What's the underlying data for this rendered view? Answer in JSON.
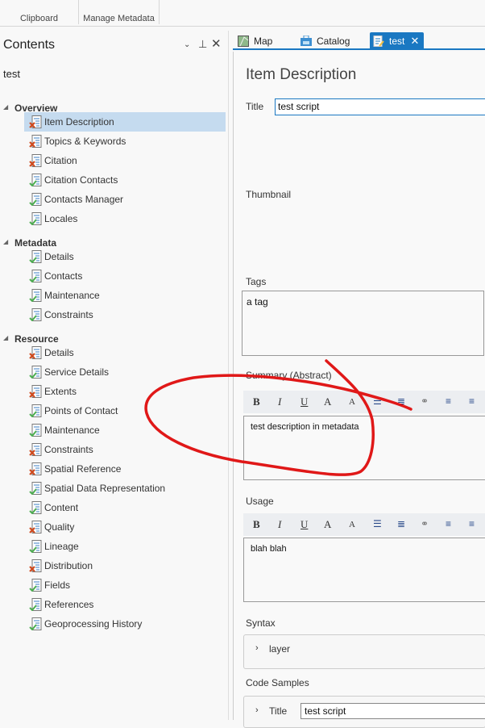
{
  "ribbon": {
    "groups": [
      "Clipboard",
      "Manage Metadata"
    ]
  },
  "contents": {
    "title": "Contents",
    "root": "test",
    "groups": [
      {
        "label": "Overview",
        "items": [
          {
            "label": "Item Description",
            "status": "error",
            "selected": true
          },
          {
            "label": "Topics & Keywords",
            "status": "error"
          },
          {
            "label": "Citation",
            "status": "error"
          },
          {
            "label": "Citation Contacts",
            "status": "ok"
          },
          {
            "label": "Contacts Manager",
            "status": "ok"
          },
          {
            "label": "Locales",
            "status": "ok"
          }
        ]
      },
      {
        "label": "Metadata",
        "items": [
          {
            "label": "Details",
            "status": "ok"
          },
          {
            "label": "Contacts",
            "status": "ok"
          },
          {
            "label": "Maintenance",
            "status": "ok"
          },
          {
            "label": "Constraints",
            "status": "ok"
          }
        ]
      },
      {
        "label": "Resource",
        "items": [
          {
            "label": "Details",
            "status": "error"
          },
          {
            "label": "Service Details",
            "status": "ok"
          },
          {
            "label": "Extents",
            "status": "error"
          },
          {
            "label": "Points of Contact",
            "status": "ok"
          },
          {
            "label": "Maintenance",
            "status": "ok"
          },
          {
            "label": "Constraints",
            "status": "error"
          },
          {
            "label": "Spatial Reference",
            "status": "error"
          },
          {
            "label": "Spatial Data Representation",
            "status": "ok"
          },
          {
            "label": "Content",
            "status": "ok"
          },
          {
            "label": "Quality",
            "status": "error"
          },
          {
            "label": "Lineage",
            "status": "ok"
          },
          {
            "label": "Distribution",
            "status": "error"
          },
          {
            "label": "Fields",
            "status": "ok"
          },
          {
            "label": "References",
            "status": "ok"
          },
          {
            "label": "Geoprocessing History",
            "status": "ok"
          }
        ]
      }
    ]
  },
  "tabs": [
    {
      "label": "Map"
    },
    {
      "label": "Catalog"
    },
    {
      "label": "test",
      "active": true
    }
  ],
  "editor": {
    "heading": "Item Description",
    "title_label": "Title",
    "title_value": "test script",
    "thumbnail_label": "Thumbnail",
    "tags_label": "Tags",
    "tags_value": "a tag",
    "summary_label": "Summary (Abstract)",
    "summary_value": "test description in metadata",
    "usage_label": "Usage",
    "usage_value": "blah blah",
    "syntax_label": "Syntax",
    "syntax_param": "layer",
    "code_samples_label": "Code Samples",
    "code_title_label": "Title",
    "code_title_value": "test script"
  },
  "toolbar": {
    "bold": "B",
    "italic": "I",
    "underline": "U",
    "grow": "A",
    "shrink": "A"
  },
  "colors": {
    "accent": "#1a78c2",
    "error": "#d04a1e",
    "ok": "#4caf50",
    "annotation": "#e01818"
  }
}
